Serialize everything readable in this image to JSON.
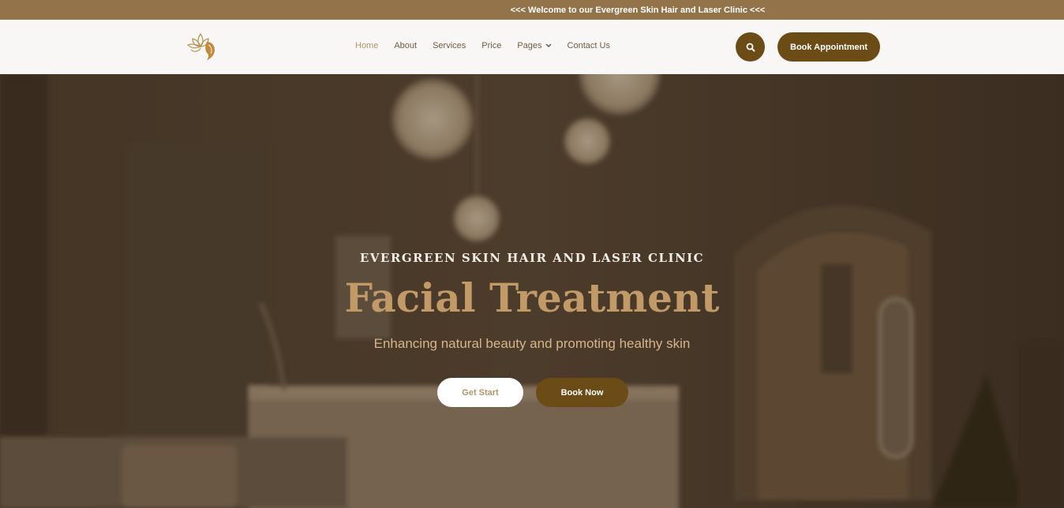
{
  "announcement": "<<< Welcome to our Evergreen Skin Hair and Laser Clinic <<<",
  "nav": {
    "items": [
      {
        "label": "Home",
        "active": true
      },
      {
        "label": "About"
      },
      {
        "label": "Services"
      },
      {
        "label": "Price"
      },
      {
        "label": "Pages",
        "dropdown": true
      },
      {
        "label": "Contact Us"
      }
    ],
    "book_appointment": "Book Appointment"
  },
  "hero": {
    "kicker": "EVERGREEN SKIN HAIR AND LASER CLINIC",
    "title": "Facial Treatment",
    "subtitle": "Enhancing natural beauty and promoting healthy skin",
    "get_start": "Get Start",
    "book_now": "Book Now"
  },
  "colors": {
    "brand": "#6b4b16",
    "topbar": "#93744a",
    "accent": "#c29a68",
    "nav_bg": "#f9f7f5"
  },
  "icons": {
    "logo": "lotus-face-logo",
    "search": "search-icon",
    "dropdown": "chevron-down-icon"
  }
}
